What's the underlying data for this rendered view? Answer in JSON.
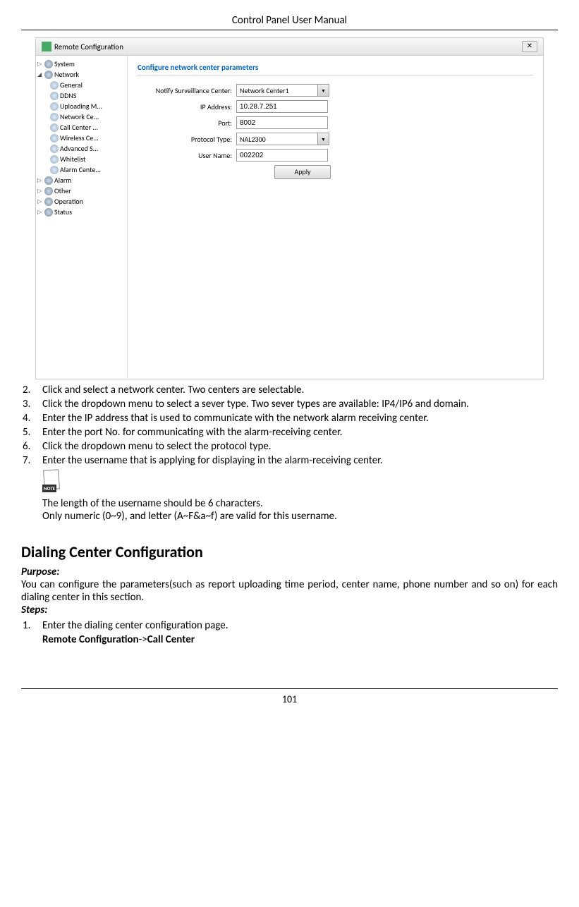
{
  "header": {
    "title": "Control Panel User Manual"
  },
  "window": {
    "title": "Remote Configuration",
    "close": "✕"
  },
  "sidebar": {
    "nodes": [
      {
        "arrow": "▷",
        "label": "System",
        "children": []
      },
      {
        "arrow": "◢",
        "label": "Network",
        "children": [
          "General",
          "DDNS",
          "Uploading M...",
          "Network Ce...",
          "Call Center ...",
          "Wireless Ce...",
          "Advanced S...",
          "Whitelist",
          "Alarm Cente..."
        ]
      },
      {
        "arrow": "▷",
        "label": "Alarm",
        "children": []
      },
      {
        "arrow": "▷",
        "label": "Other",
        "children": []
      },
      {
        "arrow": "▷",
        "label": "Operation",
        "children": []
      },
      {
        "arrow": "▷",
        "label": "Status",
        "children": []
      }
    ]
  },
  "panel": {
    "heading": "Configure network center parameters",
    "fields": {
      "notify_label": "Notify Surveillance Center:",
      "notify_value": "Network Center1",
      "ip_label": "IP Address:",
      "ip_value": "10.28.7.251",
      "port_label": "Port:",
      "port_value": "8002",
      "protocol_label": "Protocol Type:",
      "protocol_value": "NAL2300",
      "user_label": "User Name:",
      "user_value": "002202"
    },
    "apply": "Apply"
  },
  "steps": {
    "s2_num": "2.",
    "s2_text": "Click and select a network center. Two centers are selectable.",
    "s3_num": "3.",
    "s3_text": "Click the dropdown menu to select a sever type. Two sever types are available: IP4/IP6 and domain.",
    "s4_num": "4.",
    "s4_text": "Enter the IP address that is used to communicate with the network alarm receiving center.",
    "s5_num": "5.",
    "s5_text": "Enter the port No. for communicating with the alarm-receiving center.",
    "s6_num": "6.",
    "s6_text": "Click the dropdown menu to select the protocol type.",
    "s7_num": "7.",
    "s7_text": "Enter the username that is applying for displaying in the alarm-receiving center."
  },
  "note": {
    "badge": "NOTE",
    "line1": "The length of the username should be 6 characters.",
    "line2": "Only numeric (0~9), and letter (A~F&a~f) are valid for this username."
  },
  "section2": {
    "heading": "Dialing Center Configuration",
    "purpose_label": "Purpose:",
    "purpose_text": "You can configure the parameters(such as report uploading time period, center name, phone number and so on) for each dialing center in this section.",
    "steps_label": "Steps:",
    "step1_num": "1.",
    "step1_text": "Enter the dialing center configuration page.",
    "nav_prefix": "Remote Configuration",
    "nav_sep": "->",
    "nav_target": "Call Center"
  },
  "footer": {
    "page": "101"
  }
}
